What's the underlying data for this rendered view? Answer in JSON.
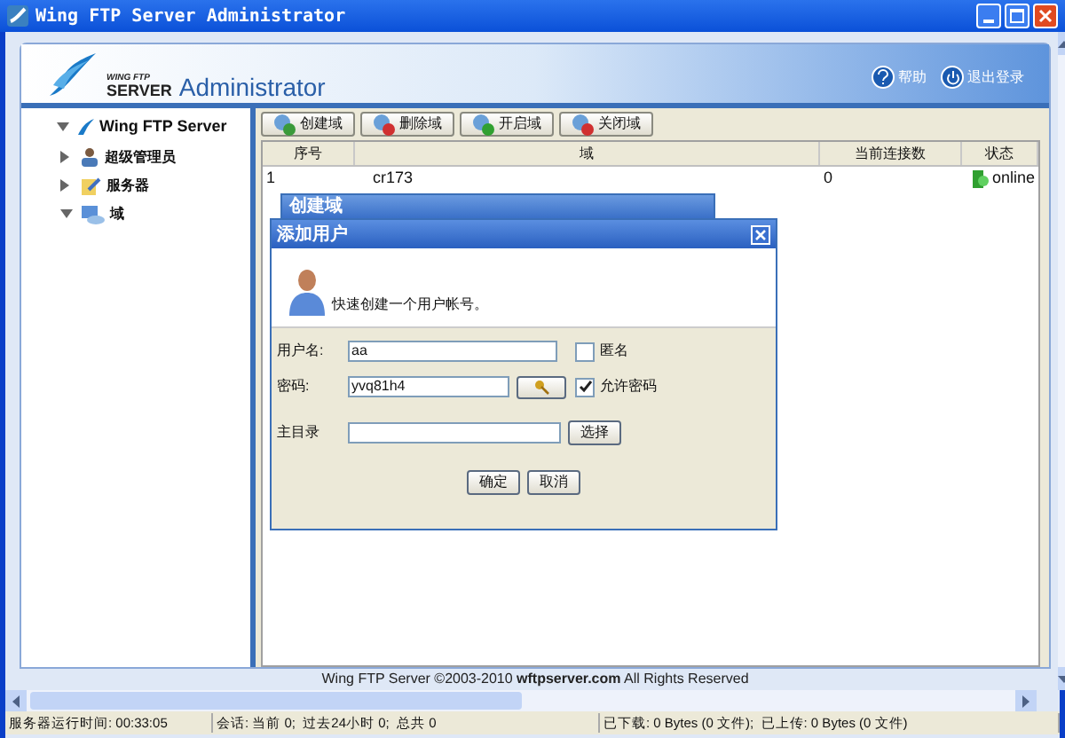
{
  "window": {
    "title": "Wing FTP Server Administrator"
  },
  "header": {
    "logo_small": "WING FTP",
    "logo_big": "SERVER",
    "product": "Administrator",
    "links": [
      {
        "label": "帮助",
        "kind": "help"
      },
      {
        "label": "退出登录",
        "kind": "logout"
      }
    ]
  },
  "tree": {
    "label": "Wing FTP Server",
    "expanded": true,
    "children": [
      {
        "label": "超级管理员",
        "expanded": false,
        "kind": "admin"
      },
      {
        "label": "服务器",
        "expanded": false,
        "kind": "server"
      },
      {
        "label": "域",
        "expanded": true,
        "kind": "domain"
      }
    ]
  },
  "toolbar": [
    {
      "label": "创建域",
      "kind": "create"
    },
    {
      "label": "删除域",
      "kind": "delete"
    },
    {
      "label": "开启域",
      "kind": "start"
    },
    {
      "label": "关闭域",
      "kind": "stop"
    }
  ],
  "table": {
    "columns": [
      "序号",
      "域",
      "当前连接数",
      "状态"
    ],
    "rows": [
      {
        "cells": [
          "1",
          "cr173",
          "0",
          "online"
        ],
        "online": true
      }
    ]
  },
  "back_dialog": {
    "title": "创建域"
  },
  "dialog": {
    "title": "添加用户",
    "intro": "快速创建一个用户帐号。",
    "username": {
      "label": "用户名:",
      "value": "aa"
    },
    "anonymous": {
      "label": "匿名",
      "checked": false
    },
    "password": {
      "label": "密码:",
      "value": "yvq81h4"
    },
    "allow_password": {
      "label": "允许密码",
      "checked": true
    },
    "home": {
      "label": "主目录",
      "button": "选择"
    },
    "buttons": [
      "确定",
      "取消"
    ]
  },
  "footer": {
    "prefix": "Wing FTP Server ©2003-2010 ",
    "site": "wftpserver.com",
    "suffix": " All Rights Reserved"
  },
  "status_bar": [
    "服务器运行时间: 00:33:05",
    "会话: 当前 0;  过去24小时 0;  总共 0",
    "已下载: 0 Bytes (0 文件);  已上传: 0 Bytes (0 文件)"
  ]
}
